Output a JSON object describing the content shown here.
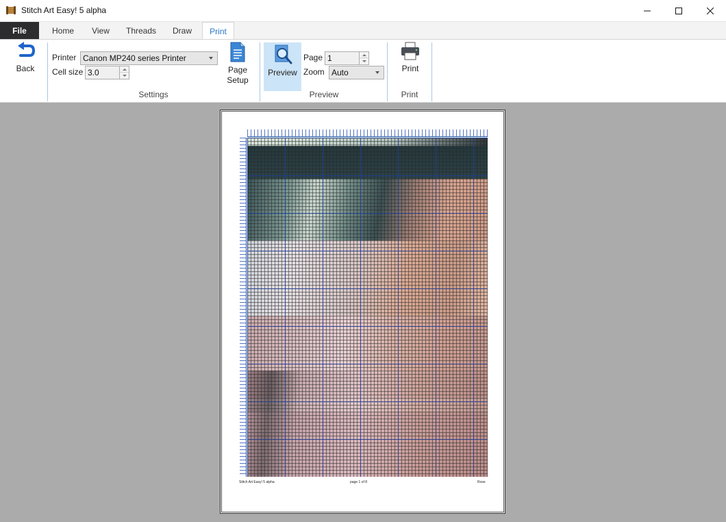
{
  "window": {
    "title": "Stitch Art Easy! 5 alpha"
  },
  "ribbon_tabs": {
    "file": "File",
    "home": "Home",
    "view": "View",
    "threads": "Threads",
    "draw": "Draw",
    "print": "Print",
    "active": "Print"
  },
  "back_button": {
    "label": "Back"
  },
  "settings": {
    "printer_label": "Printer",
    "printer_value": "Canon MP240 series Printer",
    "cell_size_label": "Cell size",
    "cell_size_value": "3.0",
    "page_setup_label_1": "Page",
    "page_setup_label_2": "Setup",
    "group_label": "Settings"
  },
  "preview_group": {
    "preview_button": "Preview",
    "page_label": "Page",
    "page_value": "1",
    "zoom_label": "Zoom",
    "zoom_value": "Auto",
    "group_label": "Preview"
  },
  "print_group": {
    "print_button": "Print",
    "group_label": "Print"
  },
  "page_preview": {
    "footer_left": "Stitch Art Easy! 5 alpha",
    "footer_center": "page 1 of 8",
    "footer_right": "Rose"
  },
  "colors": {
    "accent": "#2b78c4",
    "file_tab": "#2d2d30",
    "preview_bg": "#ababab",
    "active_button_bg": "#cce4f7"
  }
}
